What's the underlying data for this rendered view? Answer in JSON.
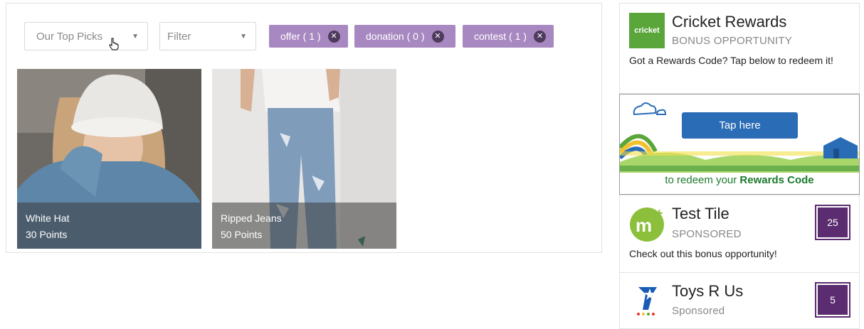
{
  "filters": {
    "sort_label": "Our Top Picks",
    "filter_label": "Filter",
    "chips": [
      {
        "label": "offer ( 1 )"
      },
      {
        "label": "donation ( 0 )"
      },
      {
        "label": "contest ( 1 )"
      }
    ]
  },
  "tiles": [
    {
      "title": "White Hat",
      "points": "30 Points"
    },
    {
      "title": "Ripped Jeans",
      "points": "50 Points"
    }
  ],
  "sidebar": {
    "cricket": {
      "logo_text": "cricket",
      "title": "Cricket Rewards",
      "subtitle": "BONUS OPPORTUNITY",
      "description": "Got a Rewards Code? Tap below to redeem it!"
    },
    "banner": {
      "button_label": "Tap here",
      "text_prefix": "to redeem your",
      "text_bold": "Rewards Code"
    },
    "test_tile": {
      "title": "Test Tile",
      "subtitle": "SPONSORED",
      "description": "Check out this bonus opportunity!",
      "points": "25"
    },
    "toys": {
      "title": "Toys R Us",
      "subtitle": "Sponsored",
      "points": "5"
    }
  },
  "colors": {
    "chip_bg": "#a888c0",
    "badge": "#5b2c6f",
    "cricket_green": "#5aa63a",
    "tap_button": "#2a6cb5"
  }
}
